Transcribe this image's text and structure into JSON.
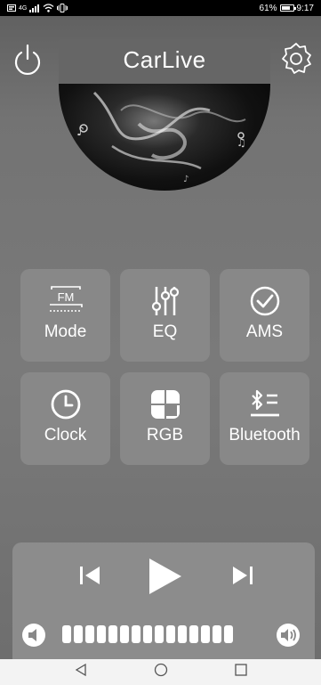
{
  "status": {
    "left_icons": [
      "message-icon",
      "signal-icon",
      "wifi-icon",
      "vibrate-icon"
    ],
    "network": "4G",
    "battery": "61%",
    "time": "9:17"
  },
  "app": {
    "title": "CarLive"
  },
  "grid": [
    {
      "label": "Mode",
      "icon": "fm-radio-icon",
      "icon_text": "FM"
    },
    {
      "label": "EQ",
      "icon": "equalizer-icon"
    },
    {
      "label": "AMS",
      "icon": "check-circle-icon"
    },
    {
      "label": "Clock",
      "icon": "clock-icon"
    },
    {
      "label": "RGB",
      "icon": "rgb-quadrant-icon"
    },
    {
      "label": "Bluetooth",
      "icon": "bluetooth-icon"
    }
  ],
  "player": {
    "volume_segments": 15,
    "volume_level": 1.0
  },
  "colors": {
    "background": "#737373",
    "tile": "#888888",
    "player_panel": "#8c8c8c",
    "icon": "#ffffff"
  }
}
